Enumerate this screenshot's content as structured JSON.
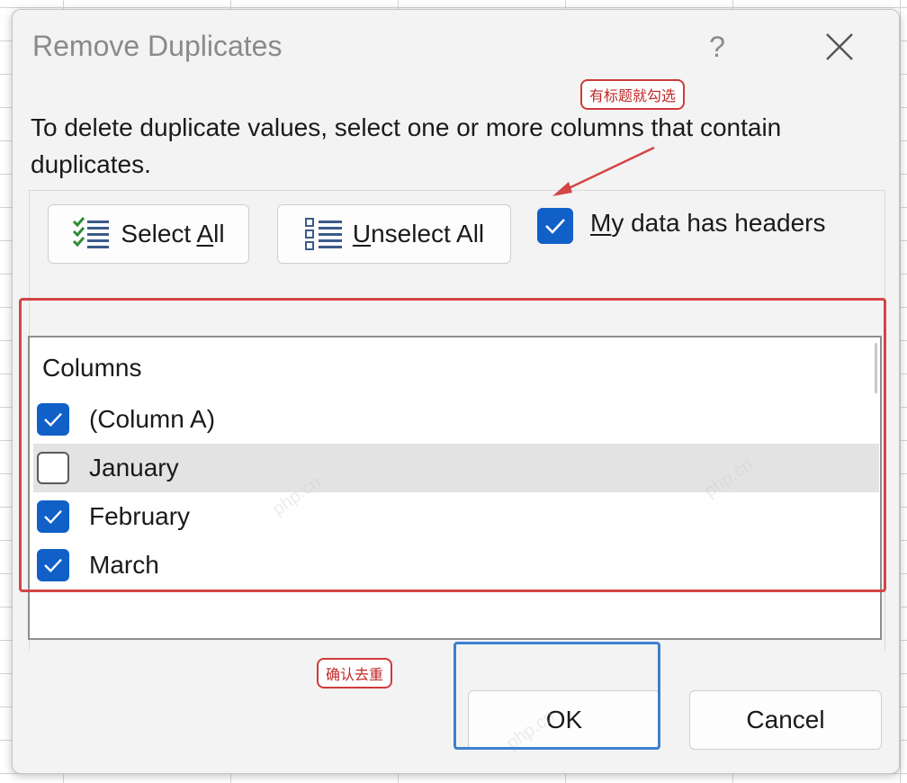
{
  "dialog": {
    "title": "Remove Duplicates",
    "help_label": "?",
    "description": "To delete duplicate values, select one or more columns that contain duplicates."
  },
  "toolbar": {
    "select_all_prefix": "Select ",
    "select_all_accel": "A",
    "select_all_suffix": "ll",
    "unselect_all_accel": "U",
    "unselect_all_suffix": "nselect All",
    "headers_accel": "M",
    "headers_suffix": "y data has headers",
    "headers_checked": true
  },
  "columns_list": {
    "header": "Columns",
    "items": [
      {
        "label": "(Column A)",
        "checked": true
      },
      {
        "label": "January",
        "checked": false,
        "selected": true
      },
      {
        "label": "February",
        "checked": true
      },
      {
        "label": "March",
        "checked": true
      }
    ]
  },
  "buttons": {
    "ok": "OK",
    "cancel": "Cancel"
  },
  "annotations": {
    "headers_note": "有标题就勾选",
    "confirm_note": "确认去重"
  },
  "watermark": "php.cn",
  "colors": {
    "accent": "#1060c8",
    "annotation_red": "#d54545",
    "annotation_blue": "#3e7fd0"
  }
}
